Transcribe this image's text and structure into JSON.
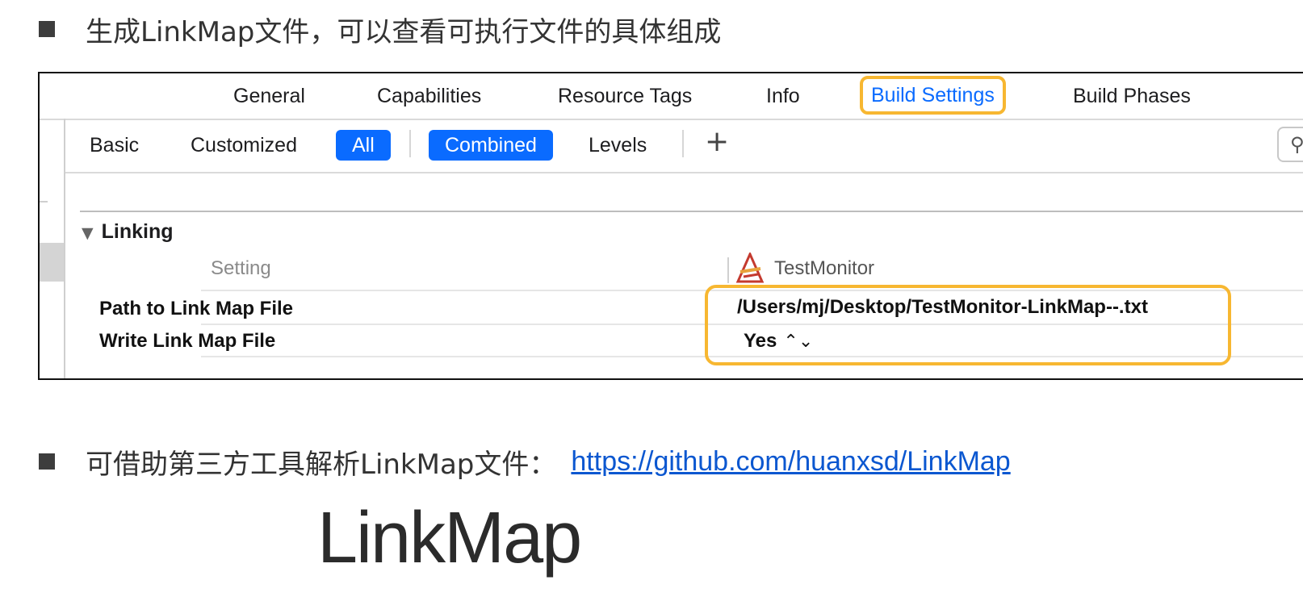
{
  "bullets": [
    {
      "text": "生成LinkMap文件，可以查看可执行文件的具体组成"
    },
    {
      "text": "可借助第三方工具解析LinkMap文件：",
      "link": "https://github.com/huanxsd/LinkMap"
    }
  ],
  "top_tabs": [
    "General",
    "Capabilities",
    "Resource Tags",
    "Info",
    "Build Settings",
    "Build Phases"
  ],
  "selected_tab": "Build Settings",
  "filters": {
    "basic": "Basic",
    "customized": "Customized",
    "all": "All",
    "combined": "Combined",
    "levels": "Levels",
    "add": "+"
  },
  "search_icon": "search-icon",
  "section": {
    "toggle": "▼",
    "title": "Linking",
    "col_setting": "Setting",
    "col_target": "TestMonitor",
    "target_icon": "xcode-app-icon"
  },
  "settings_rows": [
    {
      "label": "Path to Link Map File",
      "value": "/Users/mj/Desktop/TestMonitor-LinkMap--.txt"
    },
    {
      "label": "Write Link Map File",
      "value": "Yes",
      "stepper": "⌃⌄"
    }
  ],
  "footer_title": "LinkMap",
  "colors": {
    "accent": "#0a6bff",
    "highlight": "#f7b731",
    "link": "#0b57d0"
  }
}
